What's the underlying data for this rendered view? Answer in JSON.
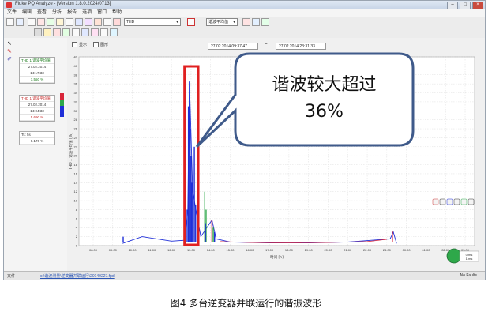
{
  "window": {
    "title": "Fluke PQ Analyze - [Version 1.8.0.2024/0713]"
  },
  "menu": [
    "文件",
    "编辑",
    "查看",
    "分析",
    "报告",
    "选项",
    "窗口",
    "帮助"
  ],
  "toolbar": {
    "dropdown1": "THD",
    "dropdown2": "谐波平均值",
    "checkbox_a": "显示",
    "checkbox_b": "图形",
    "time_start": "27.02.2014 09:37:47",
    "time_end": "27.02.2014 23:31:33"
  },
  "left_panel": {
    "legend1": {
      "header": "THD 1 谐波平均值",
      "date": "27.02.2014",
      "time": "14:17:33",
      "value": "1.550 %"
    },
    "legend2": {
      "header": "THD 1 谐波平均值",
      "date": "27.02.2014",
      "time": "14:04:33",
      "value": "5.690 %"
    },
    "legend3": {
      "header": "Ts: 5s",
      "value": "0.176 %"
    }
  },
  "chart": {
    "ylabel": "THD 1 谐波平均值 [%]",
    "xlabel": "时间 [h]",
    "yticks": [
      "42",
      "40",
      "38",
      "36",
      "34",
      "32",
      "30",
      "28",
      "26",
      "24",
      "22",
      "20",
      "18",
      "16",
      "14",
      "12",
      "10",
      "8",
      "6",
      "4",
      "2",
      "0"
    ],
    "xticks": [
      "08:00",
      "09:00",
      "10:00",
      "11:00",
      "12:00",
      "13:00",
      "14:00",
      "15:00",
      "16:00",
      "17:00",
      "18:00",
      "19:00",
      "20:00",
      "21:00",
      "22:00",
      "23:00",
      "00:00",
      "01:00",
      "02:00",
      "03:00"
    ]
  },
  "callout": {
    "line1": "谐波较大超过",
    "line2": "36%"
  },
  "status": {
    "left": "文件",
    "link": "c:\\谐波测量\\逆变器并联运行\\20140227.fpd",
    "right": "No Faults"
  },
  "badge": {
    "line1": "0 ms",
    "line2": "1 ms"
  },
  "caption": "图4 多台逆变器并联运行的谐振波形",
  "colors": {
    "series_blue": "#1f2fd8",
    "series_red": "#d8263a",
    "series_green": "#2ea84a",
    "highlight_box": "#e02020",
    "callout_border": "#3f5a8a"
  },
  "chart_data": {
    "type": "line",
    "ylim": [
      0,
      42
    ],
    "series": [
      {
        "values_note": "",
        "x": [
          "09:30",
          "10:30",
          "12:00",
          "12:40",
          "12:50",
          "12:55",
          "13:05",
          "13:30",
          "14:04",
          "14:17",
          "15:00",
          "17:00",
          "19:00",
          "21:00",
          "23:10",
          "23:20",
          "23:30"
        ],
        "values": [
          0.5,
          2.0,
          1.0,
          1.2,
          7.5,
          36.5,
          12.0,
          2.0,
          5.7,
          1.5,
          0.8,
          0.6,
          0.6,
          0.8,
          1.5,
          3.0,
          0.5
        ]
      }
    ]
  }
}
